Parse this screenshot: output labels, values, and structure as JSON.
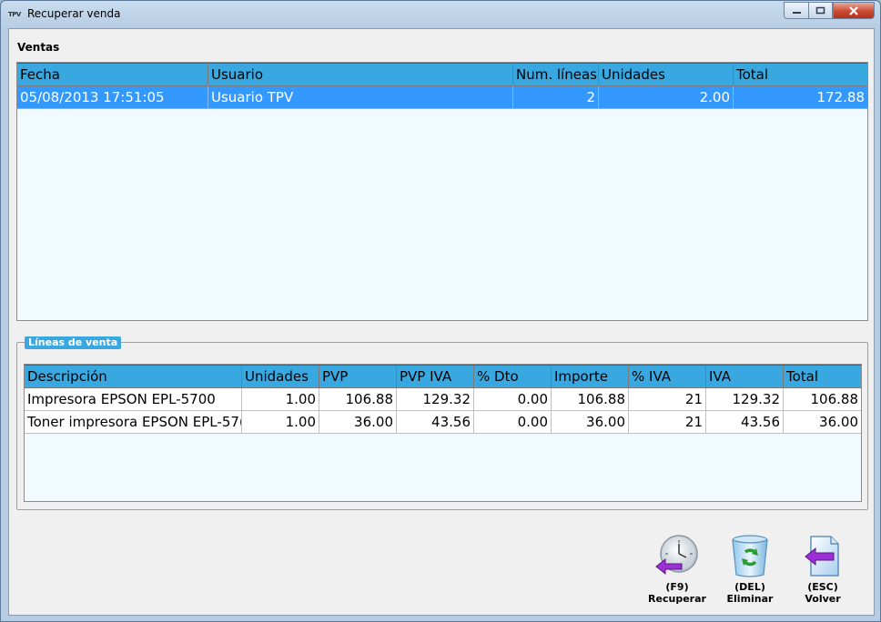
{
  "window": {
    "title": "Recuperar venda",
    "app_icon_text": "TPV"
  },
  "ventas": {
    "title": "Ventas",
    "columns": [
      "Fecha",
      "Usuario",
      "Num. líneas",
      "Unidades",
      "Total"
    ],
    "rows": [
      {
        "fecha": "05/08/2013 17:51:05",
        "usuario": "Usuario TPV",
        "num_lineas": "2",
        "unidades": "2.00",
        "total": "172.88"
      }
    ]
  },
  "lineas": {
    "title": "Líneas de venta",
    "columns": [
      "Descripción",
      "Unidades",
      "PVP",
      "PVP IVA",
      "% Dto",
      "Importe",
      "% IVA",
      "IVA",
      "Total"
    ],
    "rows": [
      {
        "descripcion": "Impresora EPSON EPL-5700",
        "unidades": "1.00",
        "pvp": "106.88",
        "pvp_iva": "129.32",
        "dto": "0.00",
        "importe": "106.88",
        "pct_iva": "21",
        "iva": "129.32",
        "total": "106.88"
      },
      {
        "descripcion": "Toner impresora EPSON EPL-57(",
        "unidades": "1.00",
        "pvp": "36.00",
        "pvp_iva": "43.56",
        "dto": "0.00",
        "importe": "36.00",
        "pct_iva": "21",
        "iva": "43.56",
        "total": "36.00"
      }
    ]
  },
  "buttons": {
    "recuperar": {
      "key": "(F9)",
      "label": "Recuperar",
      "icon": "clock-arrow-icon"
    },
    "eliminar": {
      "key": "(DEL)",
      "label": "Eliminar",
      "icon": "recycle-bin-icon"
    },
    "volver": {
      "key": "(ESC)",
      "label": "Volver",
      "icon": "document-back-icon"
    }
  },
  "colors": {
    "header": "#3aa8e0",
    "selected_row": "#3399ff",
    "grid_bg": "#f0faff",
    "arrow": "#9b30d6"
  }
}
